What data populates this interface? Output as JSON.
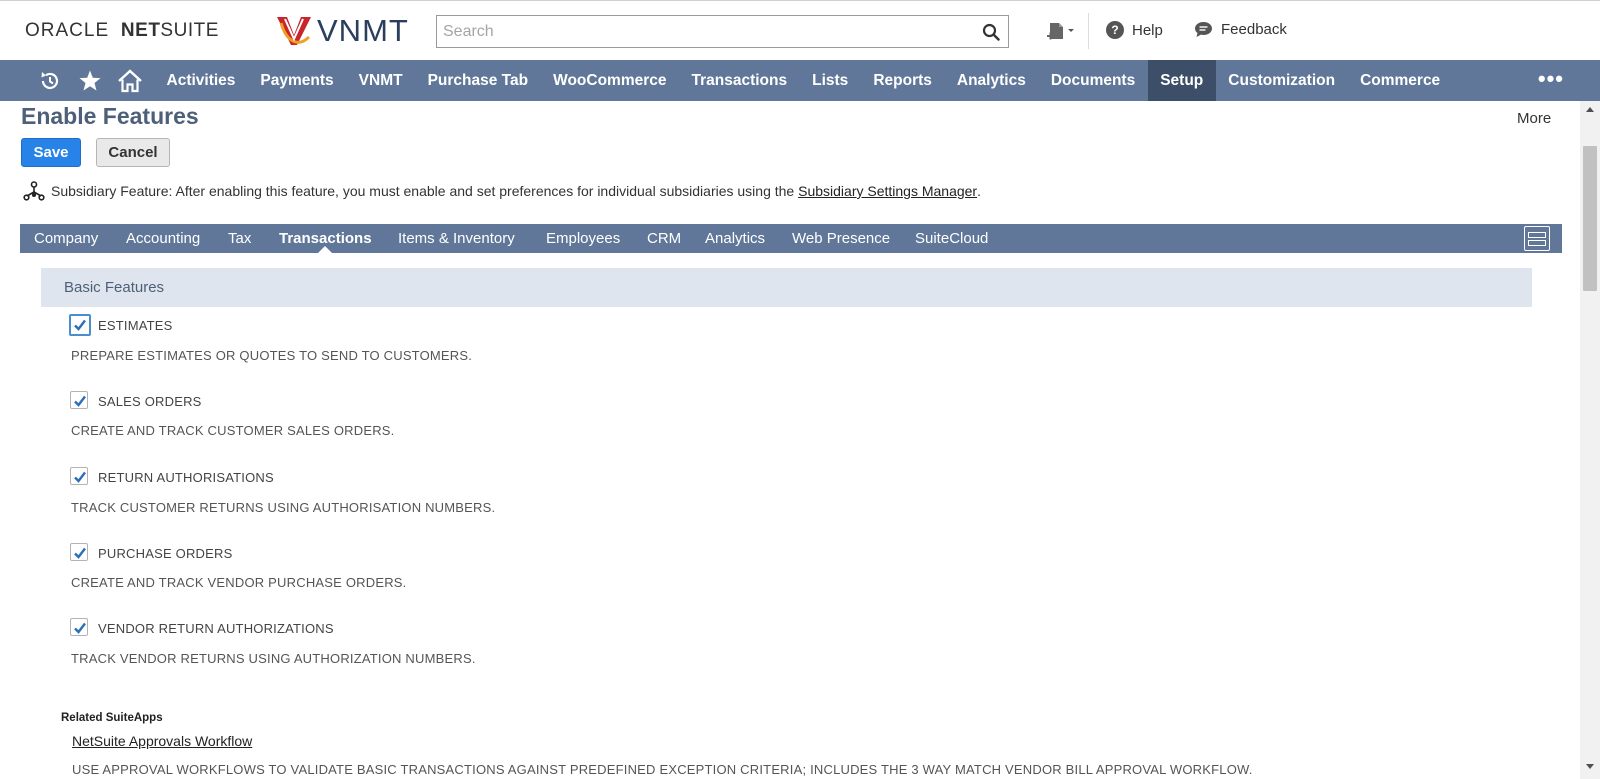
{
  "header": {
    "logo_oracle": "ORACLE",
    "logo_netsuite_bold": "NET",
    "logo_netsuite_rest": "SUITE",
    "logo_company": "VNMT",
    "search_placeholder": "Search",
    "help_label": "Help",
    "feedback_label": "Feedback"
  },
  "nav": {
    "items": [
      {
        "label": "Activities"
      },
      {
        "label": "Payments"
      },
      {
        "label": "VNMT"
      },
      {
        "label": "Purchase Tab"
      },
      {
        "label": "WooCommerce"
      },
      {
        "label": "Transactions"
      },
      {
        "label": "Lists"
      },
      {
        "label": "Reports"
      },
      {
        "label": "Analytics"
      },
      {
        "label": "Documents"
      },
      {
        "label": "Setup",
        "active": true
      },
      {
        "label": "Customization"
      },
      {
        "label": "Commerce"
      }
    ],
    "more": "•••"
  },
  "page": {
    "title": "Enable Features",
    "more_label": "More",
    "save_label": "Save",
    "cancel_label": "Cancel",
    "subsidiary_note": "Subsidiary Feature: After enabling this feature, you must enable and set preferences for individual subsidiaries using the ",
    "subsidiary_link": "Subsidiary Settings Manager",
    "subsidiary_end": "."
  },
  "subtabs": {
    "company": "Company",
    "accounting": "Accounting",
    "tax": "Tax",
    "transactions": "Transactions",
    "items": "Items & Inventory",
    "employees": "Employees",
    "crm": "CRM",
    "analytics": "Analytics",
    "web": "Web Presence",
    "suitecloud": "SuiteCloud",
    "active": "Transactions"
  },
  "section": {
    "title": "Basic Features"
  },
  "features": [
    {
      "label": "ESTIMATES",
      "desc": "PREPARE ESTIMATES OR QUOTES TO SEND TO CUSTOMERS.",
      "checked": true
    },
    {
      "label": "SALES ORDERS",
      "desc": "CREATE AND TRACK CUSTOMER SALES ORDERS.",
      "checked": true
    },
    {
      "label": "RETURN AUTHORISATIONS",
      "desc": "TRACK CUSTOMER RETURNS USING AUTHORISATION NUMBERS.",
      "checked": true
    },
    {
      "label": "PURCHASE ORDERS",
      "desc": "CREATE AND TRACK VENDOR PURCHASE ORDERS.",
      "checked": true
    },
    {
      "label": "VENDOR RETURN AUTHORIZATIONS",
      "desc": "TRACK VENDOR RETURNS USING AUTHORIZATION NUMBERS.",
      "checked": true
    }
  ],
  "related": {
    "title": "Related SuiteApps",
    "link": "NetSuite Approvals Workflow",
    "desc": "USE APPROVAL WORKFLOWS TO VALIDATE BASIC TRANSACTIONS AGAINST PREDEFINED EXCEPTION CRITERIA; INCLUDES THE 3 WAY MATCH VENDOR BILL APPROVAL WORKFLOW."
  },
  "colors": {
    "nav_bg": "#607799",
    "nav_active": "#3d4f68",
    "save_button": "#2783e8",
    "title": "#4d5f79",
    "section_bg": "#dfe5ee"
  }
}
